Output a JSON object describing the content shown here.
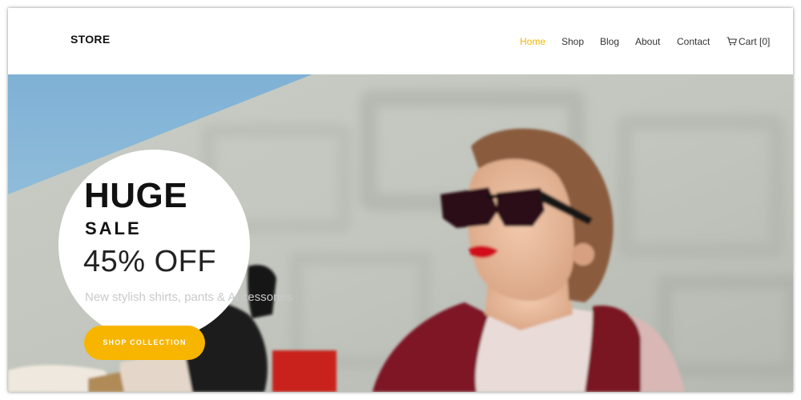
{
  "header": {
    "brand": "STORE",
    "nav": [
      {
        "label": "Home",
        "active": true
      },
      {
        "label": "Shop",
        "active": false
      },
      {
        "label": "Blog",
        "active": false
      },
      {
        "label": "About",
        "active": false
      },
      {
        "label": "Contact",
        "active": false
      }
    ],
    "cart": {
      "icon": "cart-icon",
      "label": "Cart [0]"
    }
  },
  "hero": {
    "headline": "HUGE",
    "subhead": "SALE",
    "discount": "45% OFF",
    "tagline": "New stylish shirts, pants & Accessories",
    "cta_label": "SHOP COLLECTION"
  },
  "colors": {
    "accent": "#f5b400",
    "button": "#f7b500",
    "text_dark": "#111111",
    "tagline": "#c9c9c9"
  }
}
